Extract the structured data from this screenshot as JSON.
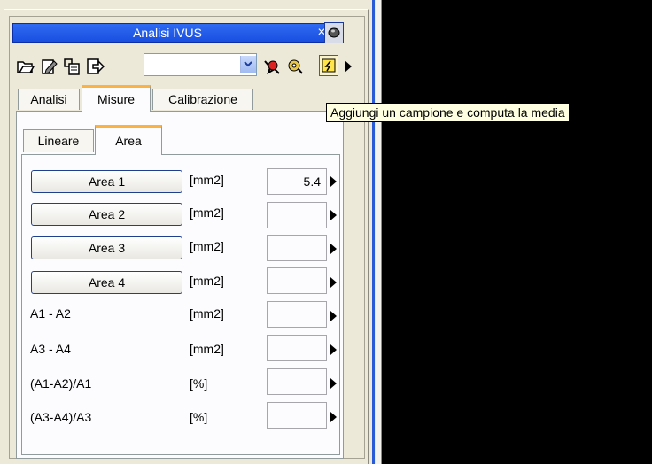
{
  "window": {
    "title": "Analisi IVUS",
    "close_glyph": "×"
  },
  "toolbar": {
    "icons": [
      "open-folder-icon",
      "edit-doc-icon",
      "scan-doc-icon",
      "export-icon"
    ],
    "combo_value": "",
    "right_icons": [
      "bug-icon",
      "gear-icon",
      "add-sample-icon",
      "more-arrow-icon"
    ]
  },
  "tabs": [
    "Analisi",
    "Misure",
    "Calibrazione"
  ],
  "subtabs": [
    "Lineare",
    "Area"
  ],
  "rows": [
    {
      "label": "Area 1",
      "unit": "[mm2]",
      "value": "5.4",
      "button": true
    },
    {
      "label": "Area 2",
      "unit": "[mm2]",
      "value": "",
      "button": true
    },
    {
      "label": "Area 3",
      "unit": "[mm2]",
      "value": "",
      "button": true
    },
    {
      "label": "Area 4",
      "unit": "[mm2]",
      "value": "",
      "button": true
    },
    {
      "label": "A1 - A2",
      "unit": "[mm2]",
      "value": "",
      "button": false
    },
    {
      "label": "A3 - A4",
      "unit": "[mm2]",
      "value": "",
      "button": false
    },
    {
      "label": "(A1-A2)/A1",
      "unit": "[%]",
      "value": "",
      "button": false
    },
    {
      "label": "(A3-A4)/A3",
      "unit": "[%]",
      "value": "",
      "button": false
    }
  ],
  "tooltip": "Aggiungi un campione e computa la media",
  "colors": {
    "titlebar": "#2f6bf2",
    "active_tab_accent": "#f9b243",
    "viewport": "#000000"
  }
}
